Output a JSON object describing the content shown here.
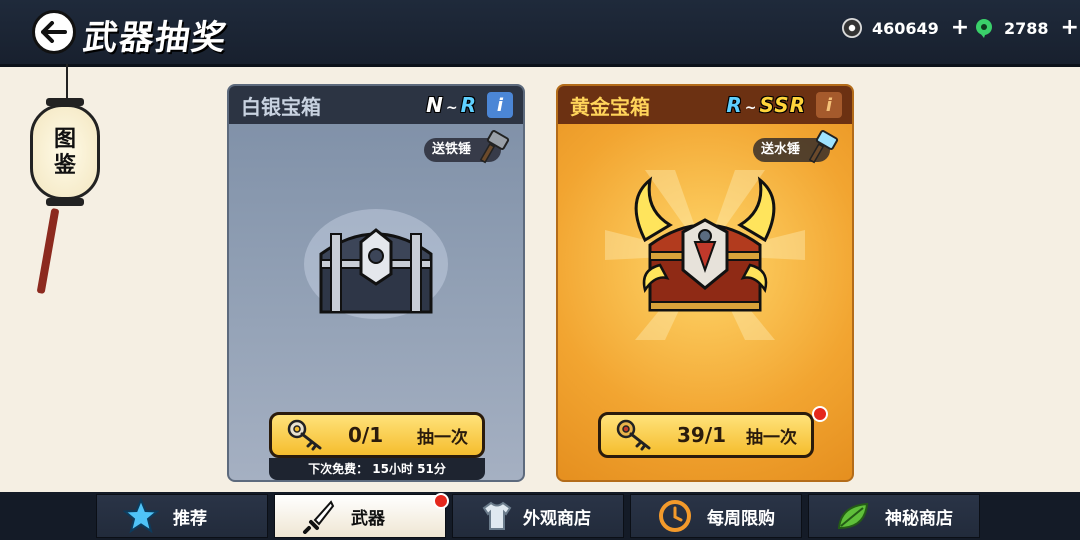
{
  "header": {
    "title": "武器抽奖",
    "coins": "460649",
    "gems": "2788",
    "plus": "+"
  },
  "side": {
    "lantern_top": "图",
    "lantern_bottom": "鉴"
  },
  "cards": [
    {
      "name": "白银宝箱",
      "rarity_from": "N",
      "rarity_to": "R",
      "tilde": "~",
      "info": "i",
      "gift": "送铁锤",
      "draw_count": "0/1",
      "draw_label": "抽一次",
      "free_timer": "下次免费： 15小时 51分"
    },
    {
      "name": "黄金宝箱",
      "rarity_from": "R",
      "rarity_to": "SSR",
      "tilde": "~",
      "info": "i",
      "gift": "送水锤",
      "draw_count": "39/1",
      "draw_label": "抽一次"
    }
  ],
  "tabs": [
    {
      "label": "推荐",
      "icon": "star-icon"
    },
    {
      "label": "武器",
      "icon": "dagger-icon"
    },
    {
      "label": "外观商店",
      "icon": "shirt-icon"
    },
    {
      "label": "每周限购",
      "icon": "clock-icon"
    },
    {
      "label": "神秘商店",
      "icon": "leaf-icon"
    }
  ],
  "colors": {
    "accent_gold": "#f5bd2e",
    "badge_red": "#e5281d",
    "bar_dark": "#1f2a3b"
  }
}
